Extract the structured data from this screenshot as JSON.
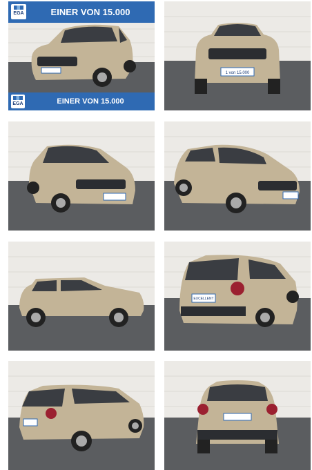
{
  "gallery": {
    "images": [
      {
        "alt": "",
        "view": "front-left"
      },
      {
        "alt": "",
        "view": "front"
      },
      {
        "alt": "",
        "view": "front-left"
      },
      {
        "alt": "",
        "view": "front-right"
      },
      {
        "alt": "",
        "view": "side-left"
      },
      {
        "alt": "",
        "view": "rear-right"
      },
      {
        "alt": "",
        "view": "rear-left"
      },
      {
        "alt": "",
        "view": "rear"
      }
    ]
  },
  "promo": {
    "banner_text": "EINER VON 15.000",
    "logo_text": "EGA"
  },
  "plates": {
    "front": "1 von 15.000",
    "rear": "EXCELLENT"
  },
  "colors": {
    "banner_blue": "#2f6ab3",
    "car_body": "#c3b497",
    "wall": "#eceae6",
    "floor": "#5b5d60"
  }
}
